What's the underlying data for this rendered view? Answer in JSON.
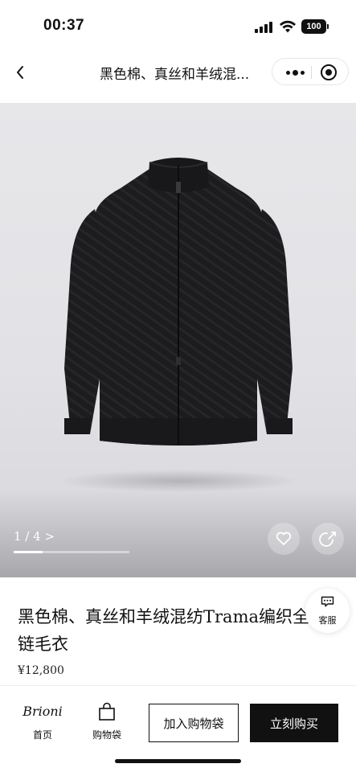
{
  "status_bar": {
    "time": "00:37",
    "battery": "100"
  },
  "nav": {
    "title": "黑色棉、真丝和羊绒混..."
  },
  "gallery": {
    "page_indicator": "1 / 4 >",
    "progress": 0.25
  },
  "product": {
    "title": "黑色棉、真丝和羊绒混纺Trama编织全链毛衣",
    "price": "¥12,800"
  },
  "customer_service": {
    "label": "客服"
  },
  "bottom_bar": {
    "brand_logo": "Brioni",
    "home_label": "首页",
    "cart_label": "购物袋",
    "add_to_cart": "加入购物袋",
    "buy_now": "立刻购买"
  },
  "colors": {
    "accent": "#111111",
    "background": "#ffffff",
    "gallery_bg": "#e4e4e8"
  }
}
